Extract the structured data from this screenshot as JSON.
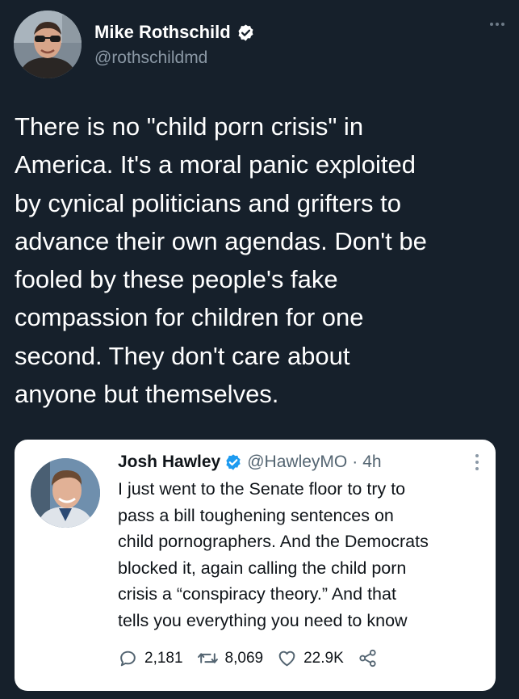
{
  "tweet": {
    "author_name": "Mike Rothschild",
    "author_handle": "@rothschildmd",
    "text": "There is no \"child porn crisis\" in\nAmerica. It's a moral panic exploited\nby cynical politicians and grifters to\nadvance their own agendas. Don't be\nfooled by these people's fake\ncompassion for children for one\nsecond. They don't care about\nanyone but themselves."
  },
  "quoted_tweet": {
    "author_name": "Josh Hawley",
    "author_handle": "@HawleyMO",
    "separator": "·",
    "time": "4h",
    "text": "I just went to the Senate floor to try to\npass a bill toughening sentences on\nchild pornographers. And the Democrats\nblocked it, again calling the child porn\ncrisis a “conspiracy theory.” And that\ntells you everything you need to know",
    "replies": "2,181",
    "retweets": "8,069",
    "likes": "22.9K"
  },
  "icons": {
    "verified": "verified-badge-icon",
    "more": "more-options-icon",
    "reply": "reply-icon",
    "retweet": "retweet-icon",
    "like": "heart-icon",
    "share": "share-icon"
  },
  "colors": {
    "background": "#16202b",
    "text_primary": "#ffffff",
    "text_secondary": "#8b98a5",
    "card_background": "#ffffff",
    "verified_dark": "#ffffff",
    "verified_light": "#1d9bf0"
  }
}
